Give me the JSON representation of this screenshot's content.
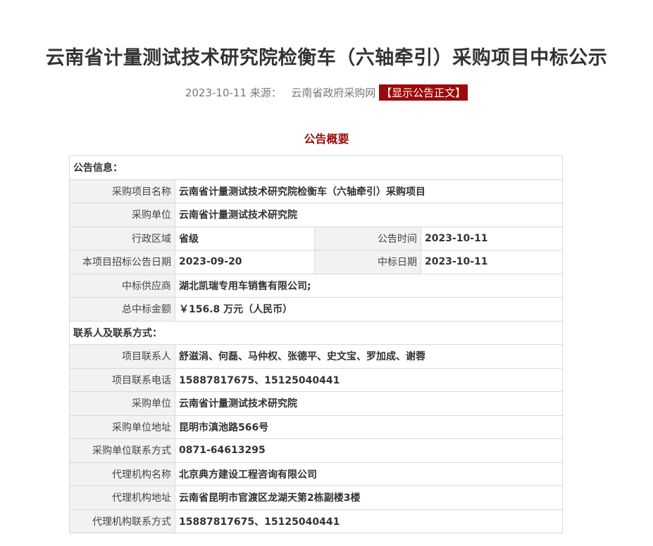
{
  "header": {
    "title": "云南省计量测试技术研究院检衡车（六轴牵引）采购项目中标公示",
    "date": "2023-10-11",
    "source_label": "来源：",
    "source_name": "云南省政府采购网",
    "show_notice_button": "【显示公告正文】"
  },
  "summary_heading": "公告概要",
  "announcement_info": {
    "section_title": "公告信息：",
    "project_name_label": "采购项目名称",
    "project_name": "云南省计量测试技术研究院检衡车（六轴牵引）采购项目",
    "purchaser_label": "采购单位",
    "purchaser": "云南省计量测试技术研究院",
    "region_label": "行政区域",
    "region": "省级",
    "announce_date_label": "公告时间",
    "announce_date": "2023-10-11",
    "tender_date_label": "本项目招标公告日期",
    "tender_date": "2023-09-20",
    "award_date_label": "中标日期",
    "award_date": "2023-10-11",
    "supplier_label": "中标供应商",
    "supplier": "湖北凯瑞专用车销售有限公司;",
    "amount_label": "总中标金额",
    "amount": "￥156.8 万元（人民币）"
  },
  "contacts": {
    "section_title": "联系人及联系方式：",
    "project_contact_label": "项目联系人",
    "project_contact": "舒滋涓、何磊、马仲权、张德平、史文宝、罗加成、谢蓉",
    "project_phone_label": "项目联系电话",
    "project_phone": "15887817675、15125040441",
    "purchaser_label": "采购单位",
    "purchaser": "云南省计量测试技术研究院",
    "purchaser_address_label": "采购单位地址",
    "purchaser_address": "昆明市滇池路566号",
    "purchaser_contact_label": "采购单位联系方式",
    "purchaser_contact": "0871-64613295",
    "agency_name_label": "代理机构名称",
    "agency_name": "北京典方建设工程咨询有限公司",
    "agency_address_label": "代理机构地址",
    "agency_address": "云南省昆明市官渡区龙湖天第2栋副楼3楼",
    "agency_contact_label": "代理机构联系方式",
    "agency_contact": "15887817675、15125040441"
  }
}
